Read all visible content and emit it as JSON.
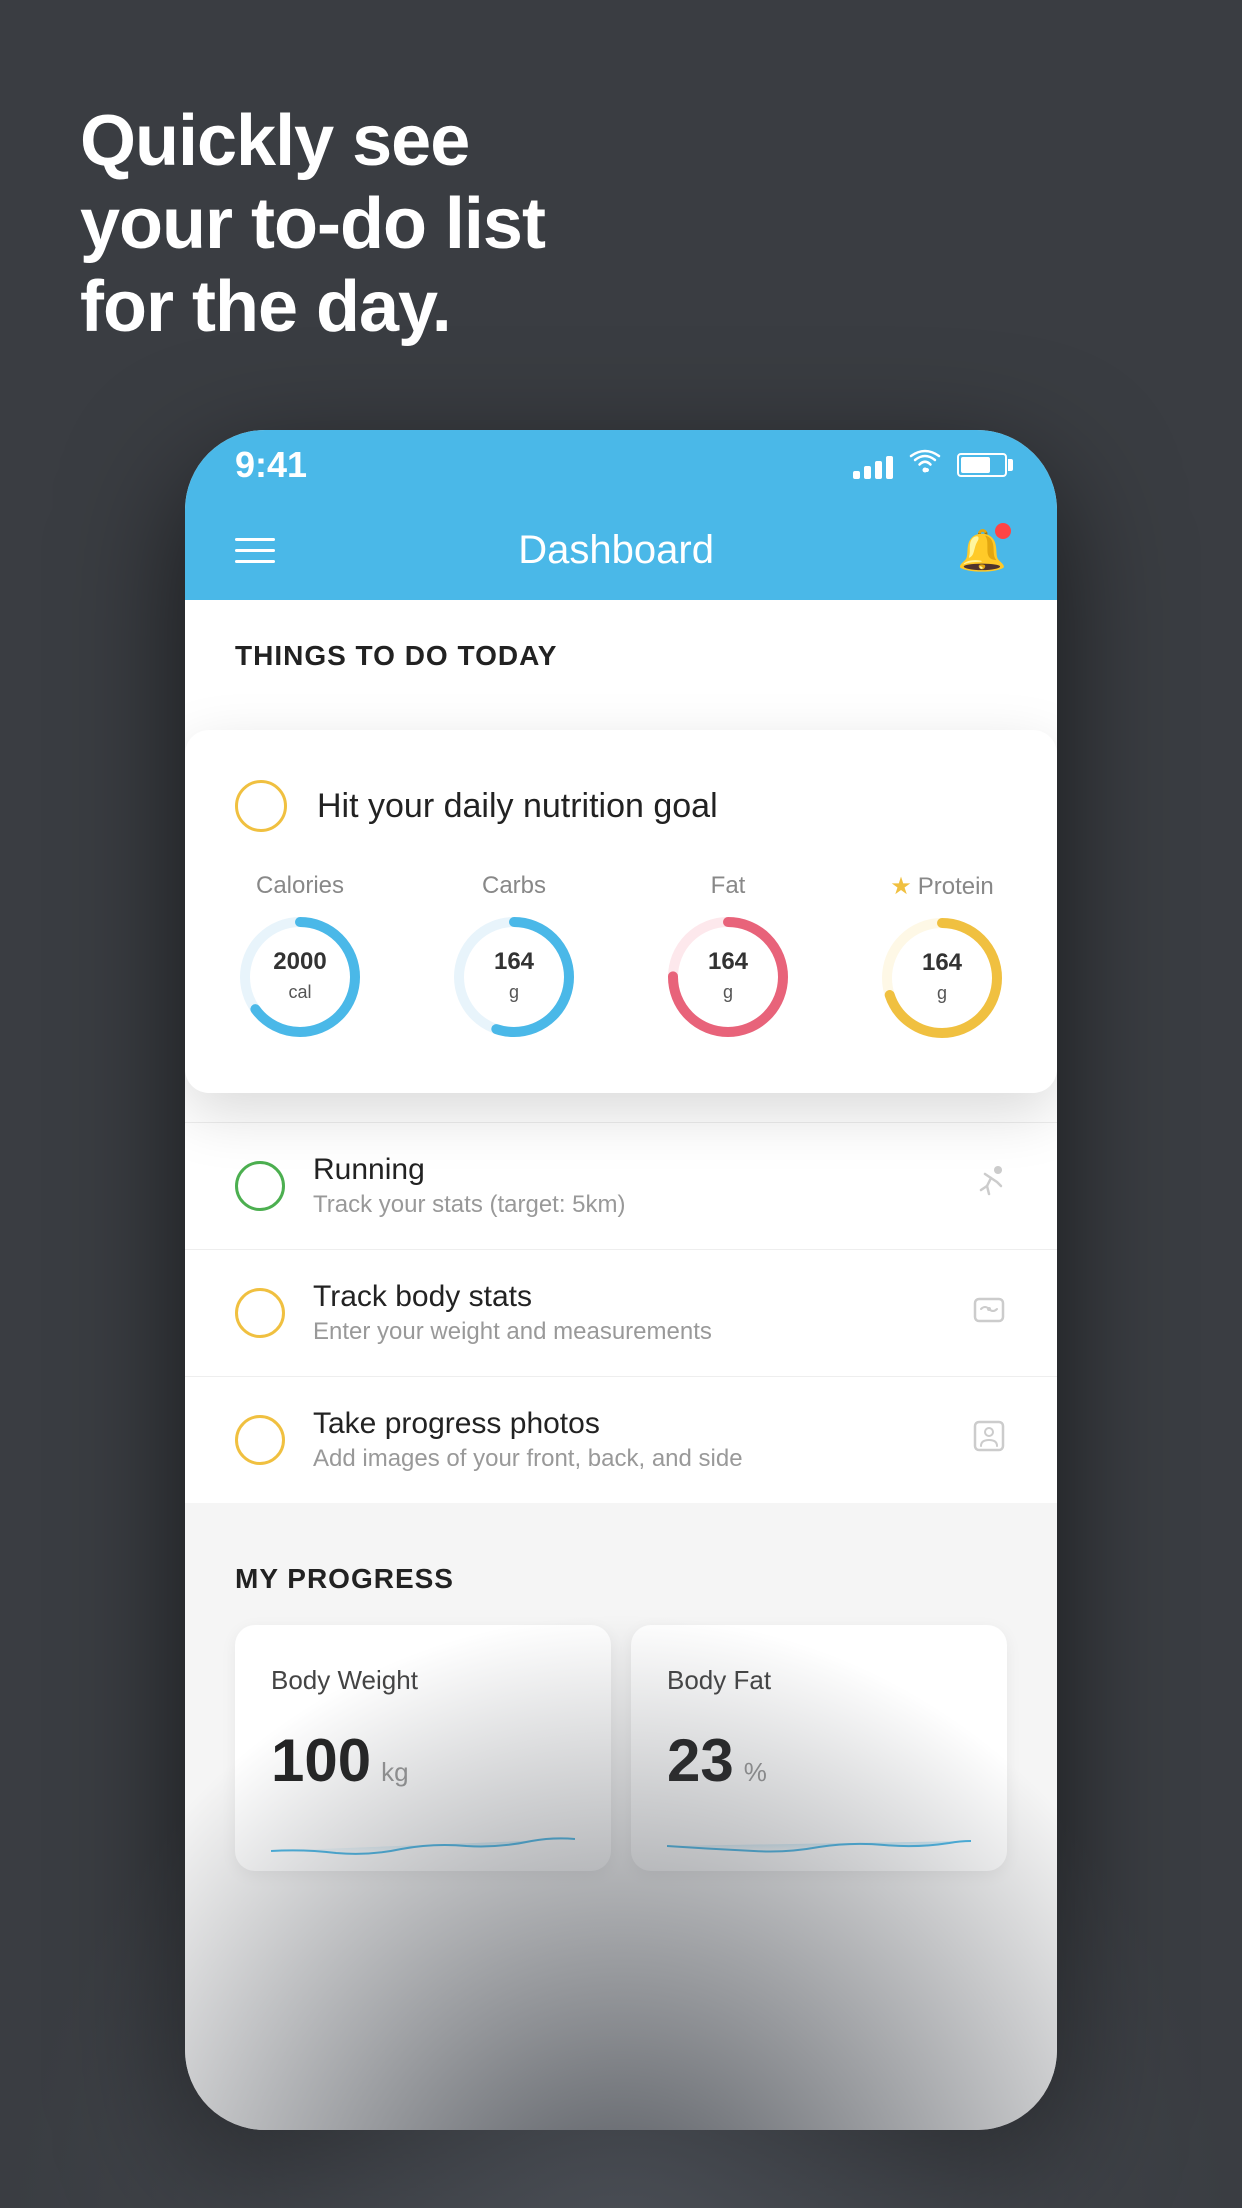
{
  "headline": {
    "line1": "Quickly see",
    "line2": "your to-do list",
    "line3": "for the day."
  },
  "statusBar": {
    "time": "9:41",
    "signalBars": [
      8,
      13,
      18,
      23
    ],
    "batteryPercent": 70
  },
  "navBar": {
    "title": "Dashboard"
  },
  "thingsSection": {
    "sectionTitle": "THINGS TO DO TODAY"
  },
  "featuredTodo": {
    "label": "Hit your daily nutrition goal",
    "circles": [
      {
        "name": "Calories",
        "value": "2000",
        "unit": "cal",
        "color": "#4ab8e8",
        "percent": 65
      },
      {
        "name": "Carbs",
        "value": "164",
        "unit": "g",
        "color": "#4ab8e8",
        "percent": 55
      },
      {
        "name": "Fat",
        "value": "164",
        "unit": "g",
        "color": "#e8637a",
        "percent": 75
      },
      {
        "name": "Protein",
        "value": "164",
        "unit": "g",
        "color": "#f0c040",
        "percent": 70,
        "starred": true
      }
    ]
  },
  "todoItems": [
    {
      "title": "Running",
      "desc": "Track your stats (target: 5km)",
      "circleColor": "green",
      "icon": "👟"
    },
    {
      "title": "Track body stats",
      "desc": "Enter your weight and measurements",
      "circleColor": "yellow",
      "icon": "⚖"
    },
    {
      "title": "Take progress photos",
      "desc": "Add images of your front, back, and side",
      "circleColor": "yellow",
      "icon": "👤"
    }
  ],
  "progressSection": {
    "title": "MY PROGRESS",
    "cards": [
      {
        "title": "Body Weight",
        "value": "100",
        "unit": "kg"
      },
      {
        "title": "Body Fat",
        "value": "23",
        "unit": "%"
      }
    ]
  }
}
